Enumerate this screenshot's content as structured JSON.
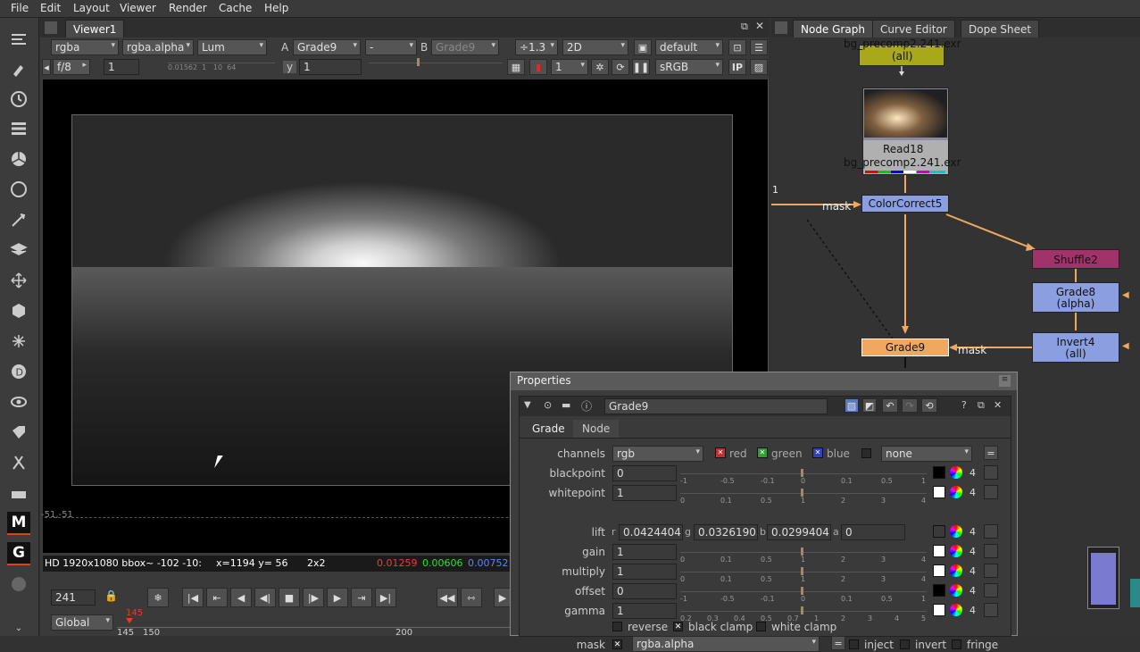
{
  "menu": [
    "File",
    "Edit",
    "Layout",
    "Viewer",
    "Render",
    "Cache",
    "Help"
  ],
  "viewer": {
    "tab": "Viewer1",
    "channels": "rgba",
    "alpha": "rgba.alpha",
    "display": "Lum",
    "a_label": "A",
    "a_input": "Grade9",
    "ab_sep": "-",
    "b_label": "B",
    "b_input": "Grade9",
    "proxy": "÷1.3",
    "view": "2D",
    "lut_default": "default",
    "fstop": "f/8",
    "gain": "1",
    "gain_ticks": "0.01562  1   10  64",
    "y_label": "y",
    "gamma": "1",
    "frame_field": "1",
    "colorspace": "sRGB",
    "ip": "IP",
    "coord": "-51,-51",
    "info": {
      "format": "HD 1920x1080 bbox~ -102 -10:",
      "xy": "x=1194 y=  56",
      "zoom": "2x2",
      "r": "0.01259",
      "g": "0.00606",
      "b": "0.00752"
    },
    "timeline": {
      "frame": "241",
      "scope": "Global",
      "current": "145",
      "ticks": [
        "145",
        "150",
        "200"
      ]
    }
  },
  "nodegraph": {
    "tabs": [
      "Node Graph",
      "Curve Editor",
      "Dope Sheet"
    ],
    "nodes": {
      "top_label": "bg_precomp2.241.exr",
      "top_sub": "(all)",
      "read": "Read18",
      "read_file": "bg_precomp2.241.exr",
      "cc": "ColorCorrect5",
      "cc_mask": "mask",
      "cc_num": "1",
      "shuffle": "Shuffle2",
      "grade8": "Grade8",
      "grade8_sub": "(alpha)",
      "invert": "Invert4",
      "invert_sub": "(all)",
      "grade9": "Grade9",
      "grade9_mask": "mask"
    }
  },
  "properties": {
    "title": "Properties",
    "node_name": "Grade9",
    "tabs": [
      "Grade",
      "Node"
    ],
    "channels": {
      "label": "channels",
      "value": "rgb",
      "red": "red",
      "green": "green",
      "blue": "blue",
      "other": "none"
    },
    "rows": [
      {
        "label": "blackpoint",
        "value": "0",
        "ticks": [
          "-1",
          "-0.5",
          "-0.1",
          "0",
          "0.1",
          "0.5",
          "1"
        ]
      },
      {
        "label": "whitepoint",
        "value": "1",
        "ticks": [
          "0",
          "0.1",
          "0.5",
          "1",
          "2",
          "3",
          "4"
        ]
      },
      {
        "label": "lift",
        "r": "0.04244047",
        "g": "0.03261905",
        "b": "0.02994047",
        "a": "0"
      },
      {
        "label": "gain",
        "value": "1",
        "ticks": [
          "0",
          "0.1",
          "0.5",
          "1",
          "2",
          "3",
          "4"
        ]
      },
      {
        "label": "multiply",
        "value": "1",
        "ticks": [
          "0",
          "0.1",
          "0.5",
          "1",
          "2",
          "3",
          "4"
        ]
      },
      {
        "label": "offset",
        "value": "0",
        "ticks": [
          "-1",
          "-0.5",
          "-0.1",
          "0",
          "0.1",
          "0.5",
          "1"
        ]
      },
      {
        "label": "gamma",
        "value": "1",
        "ticks": [
          "0.2",
          "0.3",
          "0.4",
          "0.5",
          "0.7",
          "1",
          "2",
          "3",
          "4",
          "5"
        ]
      }
    ],
    "four": "4",
    "lift_letters": {
      "r": "r",
      "g": "g",
      "b": "b",
      "a": "a"
    },
    "reverse": "reverse",
    "black_clamp": "black clamp",
    "white_clamp": "white clamp",
    "mask": {
      "label": "mask",
      "value": "rgba.alpha",
      "inject": "inject",
      "invert": "invert",
      "fringe": "fringe"
    }
  }
}
